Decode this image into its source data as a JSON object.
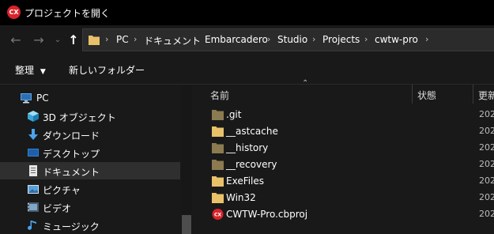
{
  "window": {
    "title": "プロジェクトを開く",
    "app_icon_text": "CX",
    "colors": {
      "background": "#191919",
      "titlebar": "#000000",
      "accent_red": "#d9242a",
      "folder": "#e8c16a",
      "folder_dim": "#8c7b50"
    }
  },
  "navigation": {
    "back_icon": "arrow-left-icon",
    "forward_icon": "arrow-right-icon",
    "recent_icon": "chevron-down-icon",
    "up_icon": "arrow-up-icon",
    "breadcrumbs": [
      "PC",
      "ドキュメント",
      "Embarcadero",
      "Studio",
      "Projects",
      "cwtw-pro"
    ]
  },
  "toolbar": {
    "organize_label": "整理",
    "new_folder_label": "新しいフォルダー"
  },
  "sidebar": {
    "items": [
      {
        "label": "PC",
        "icon": "computer-icon"
      },
      {
        "label": "3D オブジェクト",
        "icon": "cube-icon"
      },
      {
        "label": "ダウンロード",
        "icon": "download-arrow-icon"
      },
      {
        "label": "デスクトップ",
        "icon": "desktop-icon"
      },
      {
        "label": "ドキュメント",
        "icon": "document-icon",
        "selected": true
      },
      {
        "label": "ピクチャ",
        "icon": "picture-icon"
      },
      {
        "label": "ビデオ",
        "icon": "video-icon"
      },
      {
        "label": "ミュージック",
        "icon": "music-icon"
      }
    ]
  },
  "file_list": {
    "columns": [
      "名前",
      "状態",
      "更新"
    ],
    "rows": [
      {
        "name": ".git",
        "type": "folder-dim",
        "date": "202"
      },
      {
        "name": "__astcache",
        "type": "folder",
        "date": "202"
      },
      {
        "name": "__history",
        "type": "folder-dim",
        "date": "202"
      },
      {
        "name": "__recovery",
        "type": "folder-dim",
        "date": "202"
      },
      {
        "name": "ExeFiles",
        "type": "folder",
        "date": "202"
      },
      {
        "name": "Win32",
        "type": "folder",
        "date": "202"
      },
      {
        "name": "CWTW-Pro.cbproj",
        "type": "project",
        "date": "202"
      }
    ]
  }
}
